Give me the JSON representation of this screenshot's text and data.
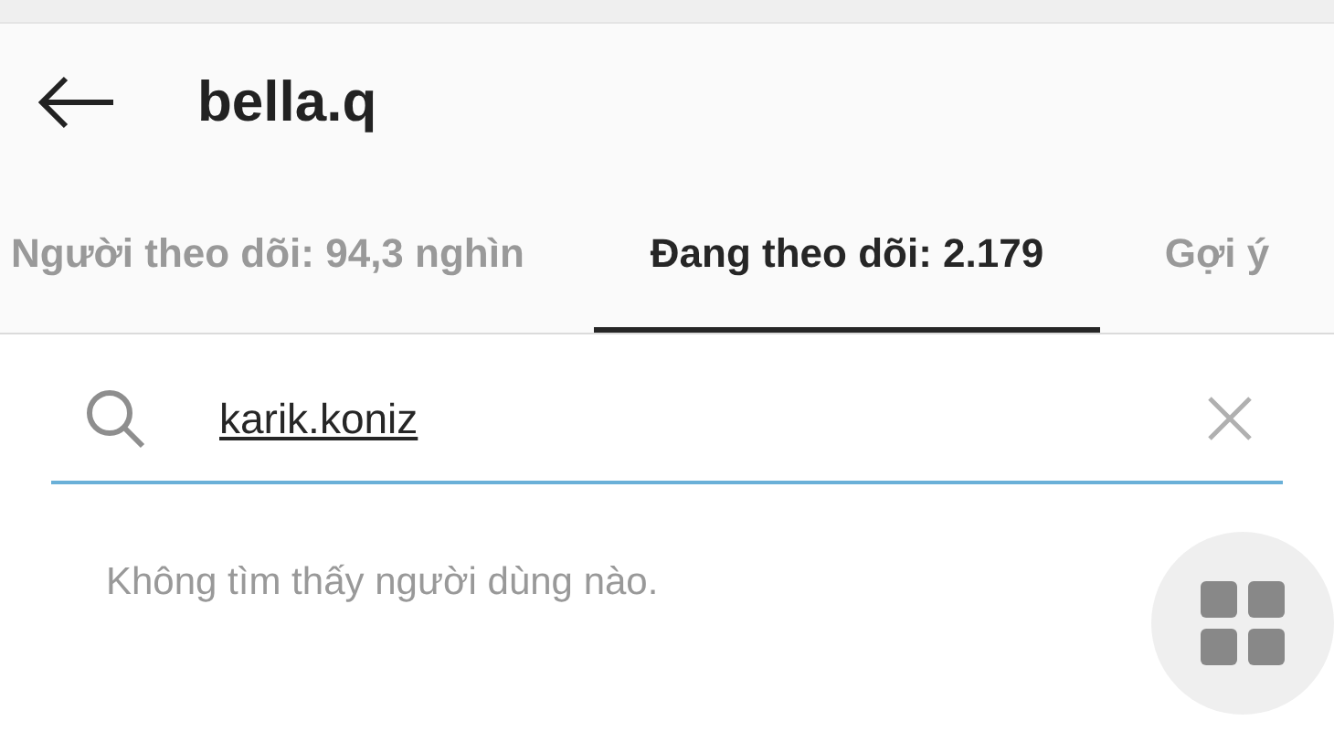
{
  "header": {
    "title": "bella.q"
  },
  "tabs": [
    {
      "label": "Người theo dõi: 94,3 nghìn",
      "selected": false
    },
    {
      "label": "Đang theo dõi: 2.179",
      "selected": true
    },
    {
      "label": "Gợi ý",
      "selected": false
    }
  ],
  "search": {
    "value": "karik.koniz"
  },
  "message": "Không tìm thấy người dùng nào."
}
